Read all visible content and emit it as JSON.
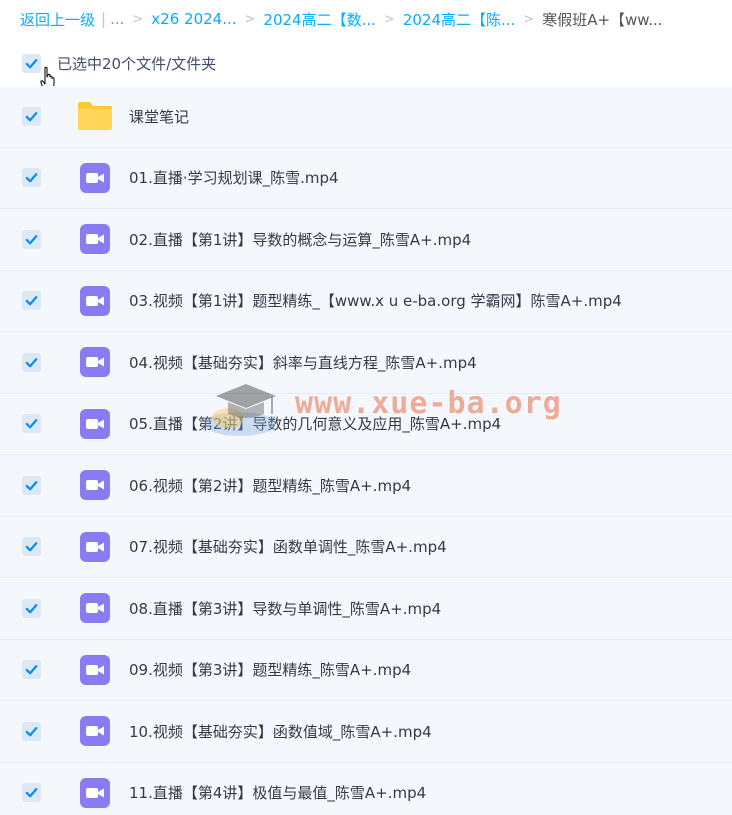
{
  "breadcrumb": {
    "back": "返回上一级",
    "ellipsis": "...",
    "items": [
      "x26 2024...",
      "2024高二【数...",
      "2024高二【陈...",
      "寒假班A+【ww..."
    ]
  },
  "selection": {
    "label": "已选中20个文件/文件夹",
    "checked": true
  },
  "files": [
    {
      "name": "课堂笔记",
      "type": "folder"
    },
    {
      "name": "01.直播·学习规划课_陈雪.mp4",
      "type": "video"
    },
    {
      "name": "02.直播【第1讲】导数的概念与运算_陈雪A+.mp4",
      "type": "video"
    },
    {
      "name": "03.视频【第1讲】题型精练_【www.x u e-ba.org 学霸网】陈雪A+.mp4",
      "type": "video"
    },
    {
      "name": "04.视频【基础夯实】斜率与直线方程_陈雪A+.mp4",
      "type": "video"
    },
    {
      "name": "05.直播【第2讲】导数的几何意义及应用_陈雪A+.mp4",
      "type": "video"
    },
    {
      "name": "06.视频【第2讲】题型精练_陈雪A+.mp4",
      "type": "video"
    },
    {
      "name": "07.视频【基础夯实】函数单调性_陈雪A+.mp4",
      "type": "video"
    },
    {
      "name": "08.直播【第3讲】导数与单调性_陈雪A+.mp4",
      "type": "video"
    },
    {
      "name": "09.视频【第3讲】题型精练_陈雪A+.mp4",
      "type": "video"
    },
    {
      "name": "10.视频【基础夯实】函数值域_陈雪A+.mp4",
      "type": "video"
    },
    {
      "name": "11.直播【第4讲】极值与最值_陈雪A+.mp4",
      "type": "video"
    }
  ],
  "watermark": {
    "text": "www.xue-ba.org"
  },
  "colors": {
    "accent": "#09aaff",
    "checkbox": "#0a8df0",
    "video_icon": "#8a7bf2",
    "folder": "#ffcf40",
    "row_bg": "#f4f8fd"
  },
  "icons": {
    "checkbox": "checkmark-icon",
    "folder": "folder-icon",
    "video": "video-camera-icon",
    "cursor": "hand-cursor-icon",
    "watermark": "graduation-cap-icon"
  }
}
